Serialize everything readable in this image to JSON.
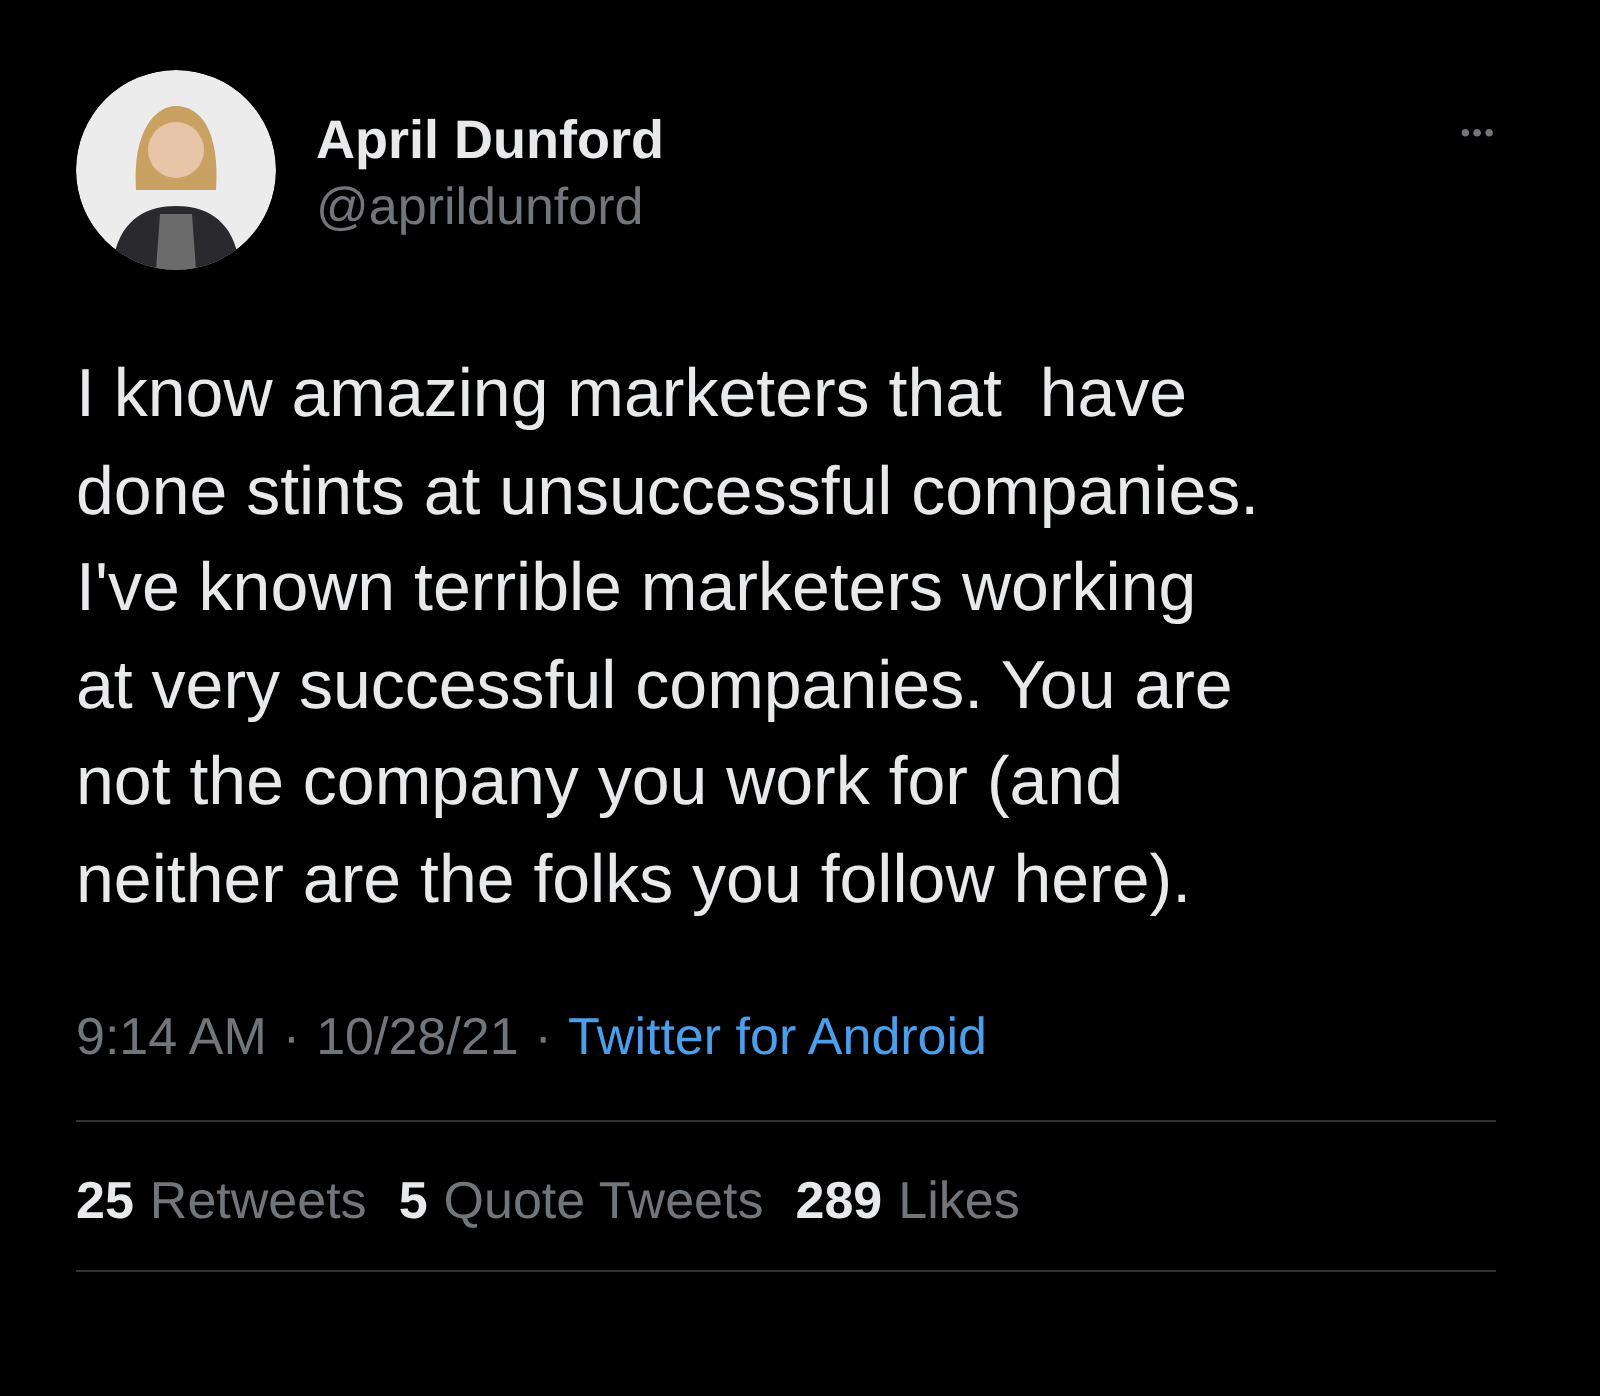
{
  "author": {
    "name": "April Dunford",
    "handle": "@aprildunford"
  },
  "more": "•••",
  "tweet": {
    "lines": [
      "I know amazing marketers that  have",
      "done stints at unsuccessful companies.",
      "I've known terrible marketers working",
      "at very successful companies. You are",
      "not the company you work for (and",
      "neither are the folks you follow here)."
    ]
  },
  "meta": {
    "time": "9:14 AM",
    "separator": "·",
    "date": "10/28/21",
    "source": "Twitter for Android"
  },
  "stats": [
    {
      "count": "25",
      "label": "Retweets"
    },
    {
      "count": "5",
      "label": "Quote Tweets"
    },
    {
      "count": "289",
      "label": "Likes"
    }
  ]
}
